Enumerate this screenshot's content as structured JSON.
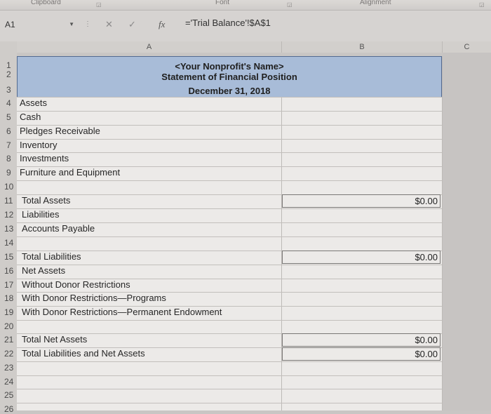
{
  "ribbon": {
    "groups": [
      "Clipboard",
      "Font",
      "Alignment"
    ]
  },
  "formula_bar": {
    "name_box": "A1",
    "fx": "fx",
    "formula": "='Trial Balance'!$A$1"
  },
  "columns": [
    "A",
    "B",
    "C"
  ],
  "header": {
    "line1": "<Your Nonprofit's Name>",
    "line2": "Statement of Financial Position",
    "line3": "December 31, 2018"
  },
  "rows": [
    {
      "num": "1",
      "label": "",
      "value": ""
    },
    {
      "num": "2",
      "label": "",
      "value": ""
    },
    {
      "num": "3",
      "label": "",
      "value": ""
    },
    {
      "num": "4",
      "label": "Assets",
      "value": ""
    },
    {
      "num": "5",
      "label": "Cash",
      "value": ""
    },
    {
      "num": "6",
      "label": "Pledges Receivable",
      "value": ""
    },
    {
      "num": "7",
      "label": "Inventory",
      "value": ""
    },
    {
      "num": "8",
      "label": "Investments",
      "value": ""
    },
    {
      "num": "9",
      "label": "Furniture and Equipment",
      "value": ""
    },
    {
      "num": "10",
      "label": "",
      "value": ""
    },
    {
      "num": "11",
      "label": "Total Assets",
      "value": "$0.00"
    },
    {
      "num": "12",
      "label": "Liabilities",
      "value": ""
    },
    {
      "num": "13",
      "label": "Accounts Payable",
      "value": ""
    },
    {
      "num": "14",
      "label": "",
      "value": ""
    },
    {
      "num": "15",
      "label": "Total Liabilities",
      "value": "$0.00"
    },
    {
      "num": "16",
      "label": "Net Assets",
      "value": ""
    },
    {
      "num": "17",
      "label": "Without Donor Restrictions",
      "value": ""
    },
    {
      "num": "18",
      "label": "With Donor Restrictions—Programs",
      "value": ""
    },
    {
      "num": "19",
      "label": "With Donor Restrictions—Permanent Endowment",
      "value": ""
    },
    {
      "num": "20",
      "label": "",
      "value": ""
    },
    {
      "num": "21",
      "label": "Total Net Assets",
      "value": "$0.00"
    },
    {
      "num": "22",
      "label": "Total Liabilities and Net Assets",
      "value": "$0.00"
    },
    {
      "num": "23",
      "label": "",
      "value": ""
    },
    {
      "num": "24",
      "label": "",
      "value": ""
    },
    {
      "num": "25",
      "label": "",
      "value": ""
    },
    {
      "num": "26",
      "label": "",
      "value": ""
    }
  ]
}
